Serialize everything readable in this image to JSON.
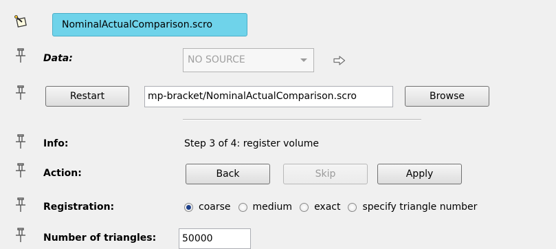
{
  "header": {
    "icon": "wand-icon",
    "title": "NominalActualComparison.scro"
  },
  "data_row": {
    "label": "Data:",
    "source_value": "NO SOURCE",
    "arrow_icon": "arrow-right-icon"
  },
  "file_row": {
    "restart_label": "Restart",
    "path_value": "mp-bracket/NominalActualComparison.scro",
    "browse_label": "Browse"
  },
  "info_row": {
    "label": "Info:",
    "value": "Step 3 of 4: register volume"
  },
  "action_row": {
    "label": "Action:",
    "back_label": "Back",
    "skip_label": "Skip",
    "apply_label": "Apply"
  },
  "registration_row": {
    "label": "Registration:",
    "options": [
      "coarse",
      "medium",
      "exact",
      "specify triangle number"
    ],
    "selected": "coarse"
  },
  "triangles_row": {
    "label": "Number of triangles:",
    "value": "50000"
  },
  "colors": {
    "title_bg": "#6fd3ea",
    "background": "#f0f0f0"
  }
}
